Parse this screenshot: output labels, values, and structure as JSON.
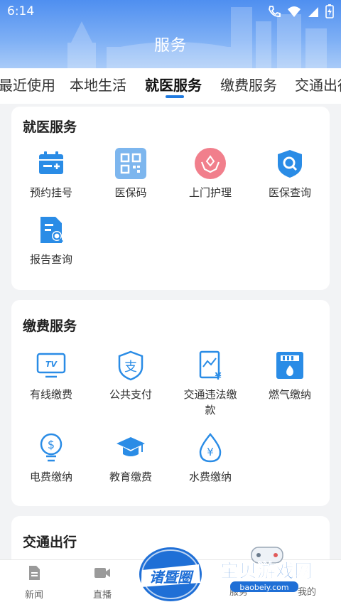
{
  "status": {
    "time": "6:14"
  },
  "page": {
    "title": "服务"
  },
  "tabs": [
    {
      "label": "最近使用"
    },
    {
      "label": "本地生活"
    },
    {
      "label": "就医服务"
    },
    {
      "label": "缴费服务"
    },
    {
      "label": "交通出行"
    }
  ],
  "sections": [
    {
      "title": "就医服务",
      "items": [
        {
          "label": "预约挂号",
          "icon": "calendar-icon"
        },
        {
          "label": "医保码",
          "icon": "qr-code-icon"
        },
        {
          "label": "上门护理",
          "icon": "care-hands-icon"
        },
        {
          "label": "医保查询",
          "icon": "shield-search-icon"
        },
        {
          "label": "报告查询",
          "icon": "report-search-icon"
        }
      ]
    },
    {
      "title": "缴费服务",
      "items": [
        {
          "label": "有线缴费",
          "icon": "tv-icon"
        },
        {
          "label": "公共支付",
          "icon": "alipay-shield-icon"
        },
        {
          "label": "交通违法缴款",
          "icon": "traffic-fine-icon"
        },
        {
          "label": "燃气缴纳",
          "icon": "gas-icon"
        },
        {
          "label": "电费缴纳",
          "icon": "electric-bulb-icon"
        },
        {
          "label": "教育缴费",
          "icon": "graduation-cap-icon"
        },
        {
          "label": "水费缴纳",
          "icon": "water-drop-icon"
        }
      ]
    },
    {
      "title": "交通出行"
    }
  ],
  "bottom_nav": [
    {
      "label": "新闻",
      "icon": "news-icon"
    },
    {
      "label": "直播",
      "icon": "video-icon"
    },
    {
      "label": "诸暨圈",
      "icon": "logo-icon"
    },
    {
      "label": "服务",
      "icon": "service-icon"
    },
    {
      "label": "我的",
      "icon": "user-icon"
    }
  ],
  "watermark": {
    "text": "宝贝游戏网",
    "sub": "baobeiy.com"
  },
  "colors": {
    "accent": "#1f7ae0",
    "icon_blue": "#2a8ce6",
    "pink": "#f17f8c"
  }
}
